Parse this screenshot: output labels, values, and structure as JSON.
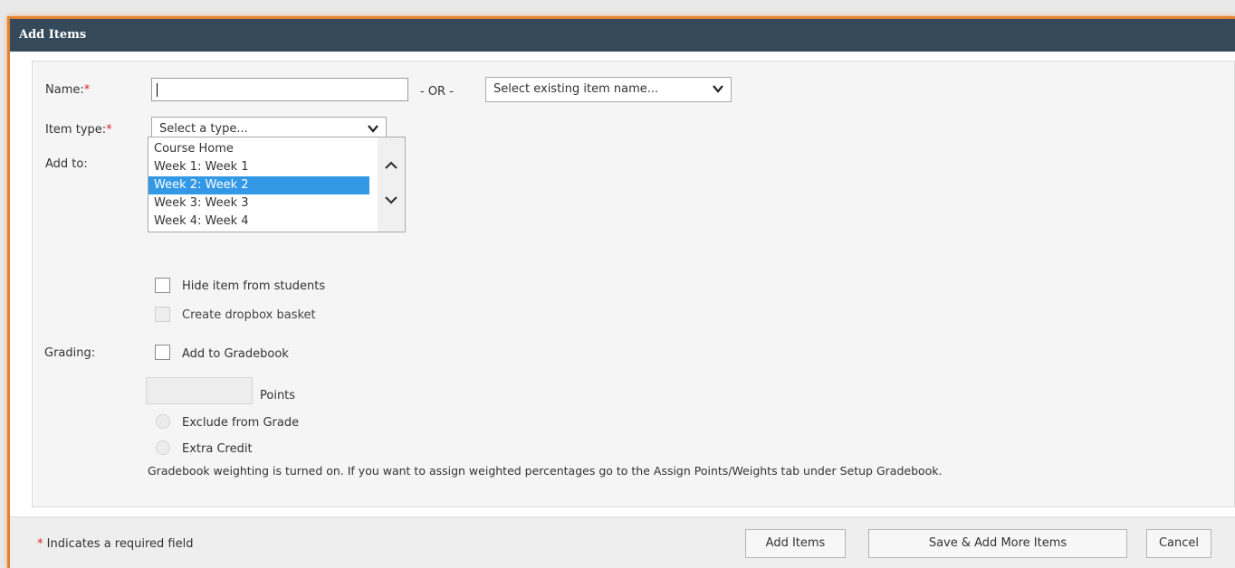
{
  "window": {
    "title": "Add Items"
  },
  "form": {
    "name_label": "Name:",
    "required_mark": "*",
    "name_value": "",
    "or_text": "- OR -",
    "existing_select": "Select existing item name...",
    "type_label": "Item type:",
    "type_select": "Select a type...",
    "add_to_label": "Add to:",
    "add_to_options": [
      "Course Home",
      "Week 1: Week 1",
      "Week 2: Week 2",
      "Week 3: Week 3",
      "Week 4: Week 4"
    ],
    "add_to_selected": "Week 2: Week 2",
    "hide_label": "Hide item from students",
    "hide_checked": false,
    "dropbox_label": "Create dropbox basket",
    "dropbox_disabled": true,
    "grading_label": "Grading:",
    "gradebook_label": "Add to Gradebook",
    "gradebook_checked": false,
    "points_value": "",
    "points_label": "Points",
    "exclude_label": "Exclude from Grade",
    "extra_label": "Extra Credit",
    "weighting_note": "Gradebook weighting is turned on. If you want to assign weighted percentages go to the Assign Points/Weights tab under Setup Gradebook."
  },
  "footer": {
    "required_mark": "*",
    "required_note": "Indicates a required field",
    "add_items_button": "Add Items",
    "save_add_more_button": "Save & Add More Items",
    "cancel_button": "Cancel"
  },
  "colors": {
    "titlebar": "#344a5a",
    "accent_border": "#e5812e",
    "selection": "#3399e6",
    "required": "#d22222"
  },
  "icons": [
    "chevron-down-icon",
    "scroll-up-icon",
    "scroll-down-icon"
  ]
}
